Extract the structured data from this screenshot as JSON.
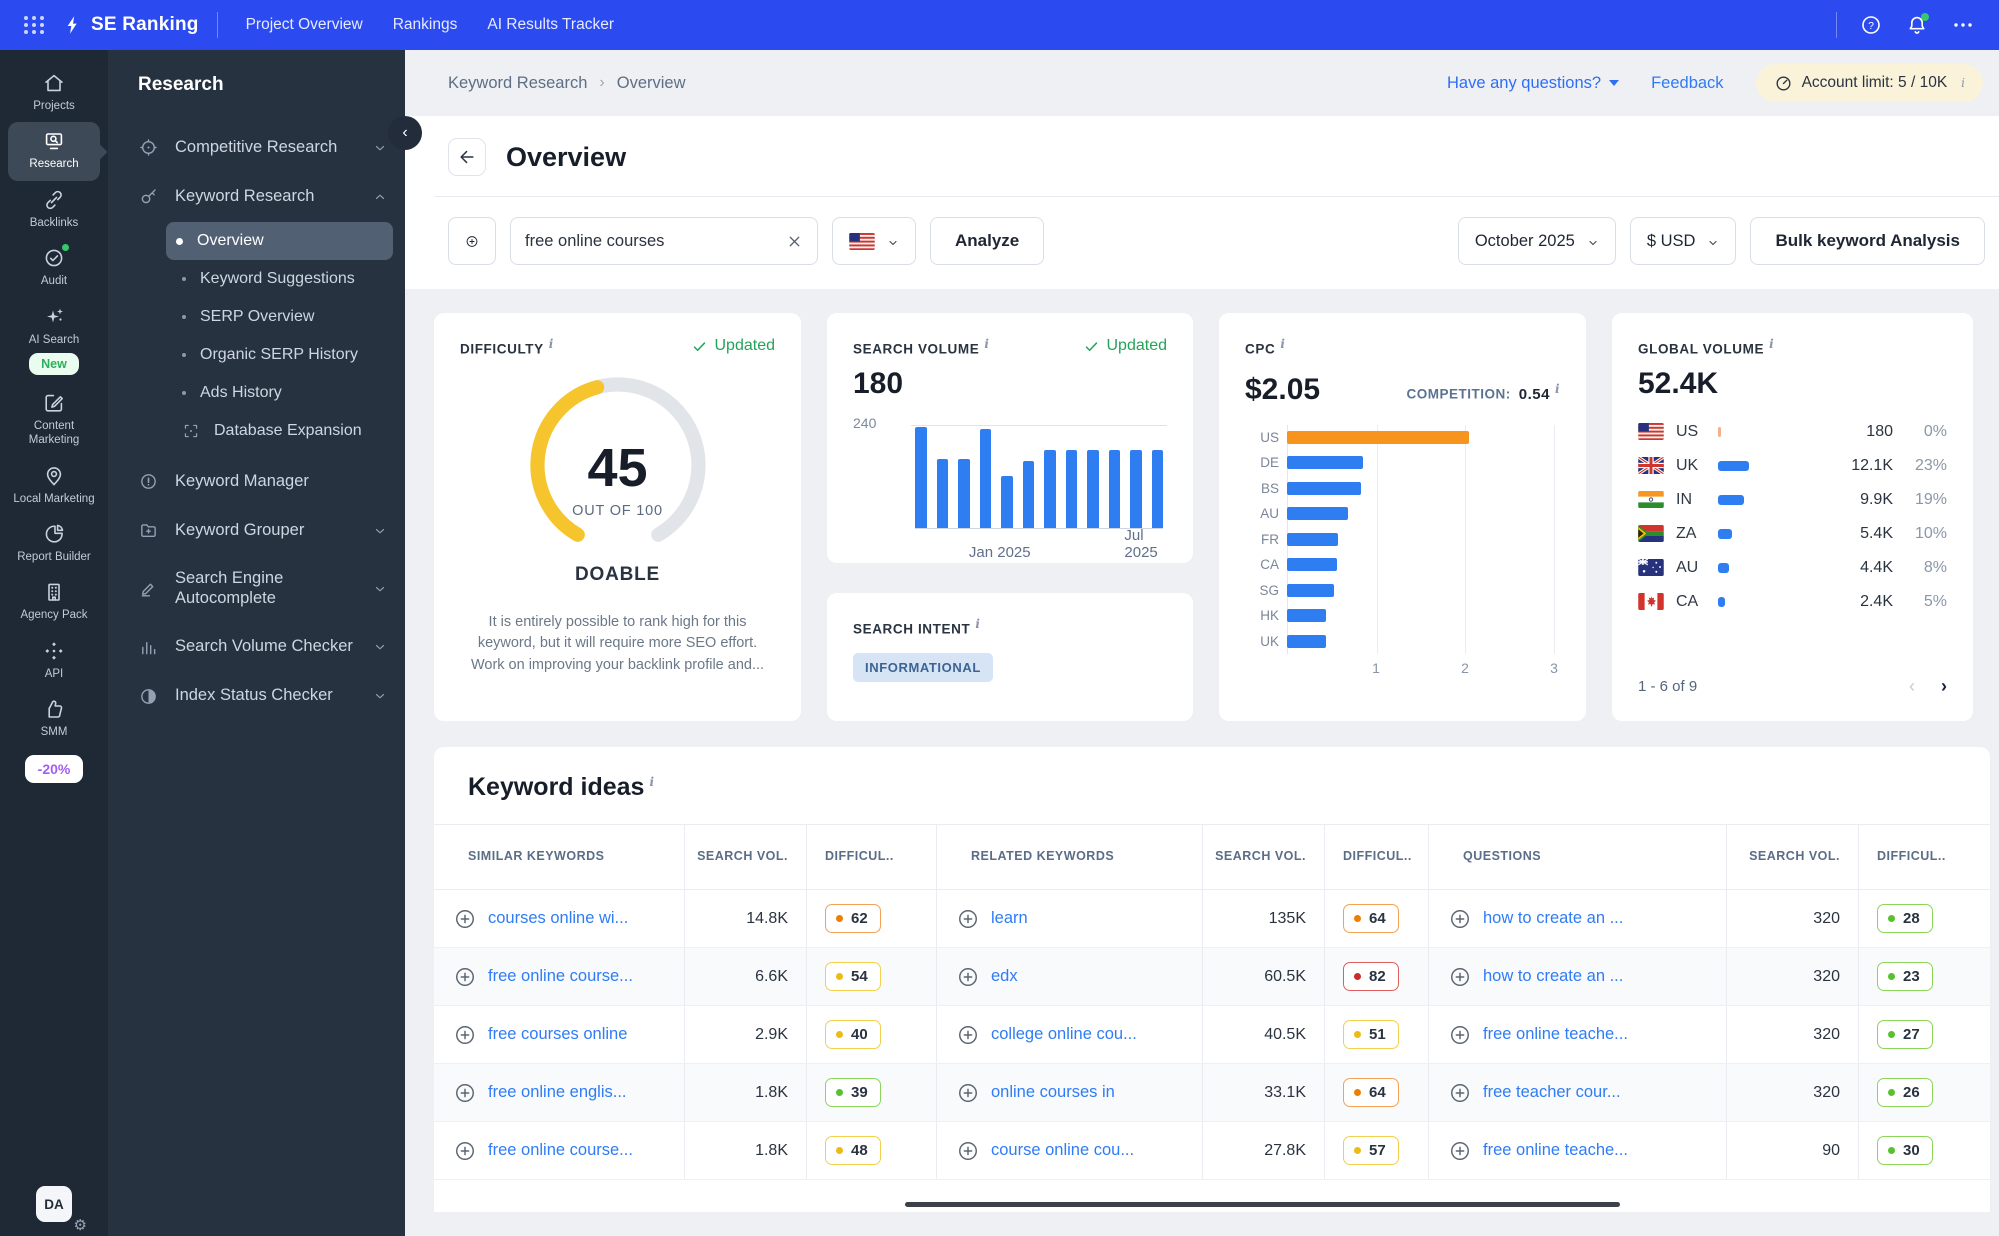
{
  "ui": {
    "info_mark": "i",
    "check_mark": "✓",
    "breadcrumb_sep": "›",
    "collapse_glyph": "‹",
    "pager_prev": "‹",
    "pager_next": "›",
    "gear_glyph": "⚙"
  },
  "topnav": {
    "brand": "SE Ranking",
    "links": [
      {
        "label": "Project Overview"
      },
      {
        "label": "Rankings"
      },
      {
        "label": "AI Results Tracker"
      }
    ]
  },
  "rail": {
    "items": [
      {
        "label": "Projects",
        "icon": "home-icon"
      },
      {
        "label": "Research",
        "icon": "research-icon",
        "active": true
      },
      {
        "label": "Backlinks",
        "icon": "link-icon"
      },
      {
        "label": "Audit",
        "icon": "audit-check-icon",
        "dot": true
      },
      {
        "label": "AI Search",
        "icon": "sparkles-icon",
        "badge": "New"
      },
      {
        "label": "Content Marketing",
        "icon": "content-edit-icon"
      },
      {
        "label": "Local Marketing",
        "icon": "map-pin-icon"
      },
      {
        "label": "Report Builder",
        "icon": "pie-chart-icon"
      },
      {
        "label": "Agency Pack",
        "icon": "building-icon"
      },
      {
        "label": "API",
        "icon": "api-icon"
      },
      {
        "label": "SMM",
        "icon": "thumb-up-icon"
      }
    ],
    "discount_badge": "-20%",
    "avatar": "DA"
  },
  "sidebar": {
    "title": "Research",
    "sections": [
      {
        "label": "Competitive Research",
        "icon": "target-icon",
        "chevron": "down"
      },
      {
        "label": "Keyword Research",
        "icon": "key-icon",
        "chevron": "up",
        "children": [
          {
            "label": "Overview",
            "active": true
          },
          {
            "label": "Keyword Suggestions"
          },
          {
            "label": "SERP Overview"
          },
          {
            "label": "Organic SERP History"
          },
          {
            "label": "Ads History"
          },
          {
            "label": "Database Expansion",
            "icon": "expand-icon"
          }
        ]
      },
      {
        "label": "Keyword Manager",
        "icon": "alert-circle-icon"
      },
      {
        "label": "Keyword Grouper",
        "icon": "folder-plus-icon",
        "chevron": "down"
      },
      {
        "label": "Search Engine Autocomplete",
        "icon": "pencil-icon",
        "chevron": "down"
      },
      {
        "label": "Search Volume Checker",
        "icon": "bar-chart-icon",
        "chevron": "down"
      },
      {
        "label": "Index Status Checker",
        "icon": "contrast-icon",
        "chevron": "down"
      }
    ]
  },
  "header": {
    "breadcrumb": [
      "Keyword Research",
      "Overview"
    ],
    "questions": "Have any questions?",
    "feedback": "Feedback",
    "account_limit": "Account limit: 5 / 10K"
  },
  "page_title": "Overview",
  "toolbar": {
    "keyword_value": "free online courses",
    "analyze_label": "Analyze",
    "period": "October 2025",
    "currency": "$ USD",
    "bulk_label": "Bulk keyword Analysis"
  },
  "cards": {
    "difficulty": {
      "label": "DIFFICULTY",
      "updated": "Updated",
      "value": "45",
      "out_of": "OUT OF 100",
      "verdict": "DOABLE",
      "description": "It is entirely possible to rank high for this keyword, but it will require more SEO effort. Work on improving your backlink profile and..."
    },
    "search_volume": {
      "label": "SEARCH VOLUME",
      "updated": "Updated",
      "value": "180",
      "axis_max": "240"
    },
    "search_intent": {
      "label": "SEARCH INTENT",
      "badge": "INFORMATIONAL"
    },
    "cpc": {
      "label": "CPC",
      "value": "$2.05",
      "competition_label": "COMPETITION:",
      "competition_value": "0.54"
    },
    "global_volume": {
      "label": "GLOBAL VOLUME",
      "value": "52.4K",
      "pagination": "1 - 6 of 9"
    }
  },
  "chart_data": [
    {
      "type": "bar",
      "title": "Search volume trend",
      "values": [
        235,
        160,
        160,
        230,
        120,
        155,
        180,
        180,
        180,
        180,
        180,
        180
      ],
      "ylim": [
        0,
        240
      ],
      "x_tick_labels": [
        {
          "label": "Jan 2025",
          "pos_pct": 27
        },
        {
          "label": "Jul 2025",
          "pos_pct": 72
        }
      ],
      "bar_color": "#2e7ef2",
      "grid": "top-line-240"
    },
    {
      "type": "bar",
      "orientation": "horizontal",
      "title": "CPC by country",
      "categories": [
        "US",
        "DE",
        "BS",
        "AU",
        "FR",
        "CA",
        "SG",
        "HK",
        "UK"
      ],
      "values": [
        2.05,
        0.85,
        0.83,
        0.68,
        0.57,
        0.56,
        0.53,
        0.44,
        0.44
      ],
      "xlim": [
        0,
        3
      ],
      "x_ticks": [
        1,
        2,
        3
      ],
      "bar_color": "#2e7ef2",
      "highlight_category": "US",
      "highlight_color": "#f7941d"
    },
    {
      "type": "table",
      "title": "Global volume by country",
      "rows": [
        {
          "code": "US",
          "flag": "us",
          "value": "180",
          "pct": "0%",
          "pct_num": 0
        },
        {
          "code": "UK",
          "flag": "uk",
          "value": "12.1K",
          "pct": "23%",
          "pct_num": 23
        },
        {
          "code": "IN",
          "flag": "in",
          "value": "9.9K",
          "pct": "19%",
          "pct_num": 19
        },
        {
          "code": "ZA",
          "flag": "za",
          "value": "5.4K",
          "pct": "10%",
          "pct_num": 10
        },
        {
          "code": "AU",
          "flag": "au",
          "value": "4.4K",
          "pct": "8%",
          "pct_num": 8
        },
        {
          "code": "CA",
          "flag": "ca",
          "value": "2.4K",
          "pct": "5%",
          "pct_num": 5
        }
      ]
    }
  ],
  "keyword_ideas": {
    "title": "Keyword ideas",
    "groups": [
      {
        "kw_header": "SIMILAR KEYWORDS",
        "vol_header": "SEARCH VOL.",
        "diff_header": "DIFFICUL..",
        "rows": [
          {
            "kw": "courses online wi...",
            "vol": "14.8K",
            "diff": "62",
            "level": "orange"
          },
          {
            "kw": "free online course...",
            "vol": "6.6K",
            "diff": "54",
            "level": "yellow"
          },
          {
            "kw": "free courses online",
            "vol": "2.9K",
            "diff": "40",
            "level": "yellow"
          },
          {
            "kw": "free online englis...",
            "vol": "1.8K",
            "diff": "39",
            "level": "green"
          },
          {
            "kw": "free online course...",
            "vol": "1.8K",
            "diff": "48",
            "level": "yellow"
          }
        ]
      },
      {
        "kw_header": "RELATED KEYWORDS",
        "vol_header": "SEARCH VOL.",
        "diff_header": "DIFFICUL..",
        "rows": [
          {
            "kw": "learn",
            "vol": "135K",
            "diff": "64",
            "level": "orange"
          },
          {
            "kw": "edx",
            "vol": "60.5K",
            "diff": "82",
            "level": "red"
          },
          {
            "kw": "college online cou...",
            "vol": "40.5K",
            "diff": "51",
            "level": "yellow"
          },
          {
            "kw": "online courses in",
            "vol": "33.1K",
            "diff": "64",
            "level": "orange"
          },
          {
            "kw": "course online cou...",
            "vol": "27.8K",
            "diff": "57",
            "level": "yellow"
          }
        ]
      },
      {
        "kw_header": "QUESTIONS",
        "vol_header": "SEARCH VOL.",
        "diff_header": "DIFFICUL..",
        "rows": [
          {
            "kw": "how to create an ...",
            "vol": "320",
            "diff": "28",
            "level": "green"
          },
          {
            "kw": "how to create an ...",
            "vol": "320",
            "diff": "23",
            "level": "green"
          },
          {
            "kw": "free online teache...",
            "vol": "320",
            "diff": "27",
            "level": "green"
          },
          {
            "kw": "free teacher cour...",
            "vol": "320",
            "diff": "26",
            "level": "green"
          },
          {
            "kw": "free online teache...",
            "vol": "90",
            "diff": "30",
            "level": "green"
          }
        ]
      }
    ]
  }
}
